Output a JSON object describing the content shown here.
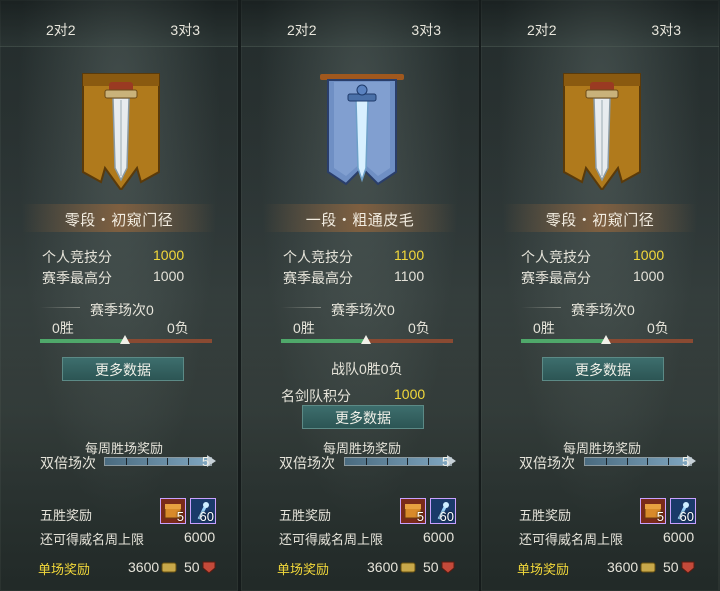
{
  "colors": {
    "gold": "#f2d83a",
    "win_bar": "#4fa86a",
    "loss_bar": "#8a4a32",
    "button": "#2c5554",
    "highlight_label": "#f2d83a"
  },
  "panels": [
    {
      "tabs": [
        "2对2",
        "3对3"
      ],
      "emblem": "gold-banner-sword-icon",
      "rank": "零段・初窥门径",
      "personal_label": "个人竞技分",
      "personal_value": "1000",
      "season_high_label": "赛季最高分",
      "season_high_value": "1000",
      "season_matches": "赛季场次0",
      "wins": "0胜",
      "losses": "0负",
      "more_button": "更多数据",
      "weekly_title": "每周胜场奖励",
      "double_label": "双倍场次",
      "double_count": "5",
      "double_progress": 1.0,
      "five_win_label": "五胜奖励",
      "item1_count": "5",
      "item2_count": "60",
      "prestige_label": "还可得威名周上限",
      "prestige_value": "6000",
      "single_label": "单场奖励",
      "single_coin": "3600",
      "single_token": "50"
    },
    {
      "tabs": [
        "2对2",
        "3对3"
      ],
      "emblem": "blue-banner-sword-icon",
      "rank": "一段・粗通皮毛",
      "personal_label": "个人竞技分",
      "personal_value": "1100",
      "season_high_label": "赛季最高分",
      "season_high_value": "1100",
      "season_matches": "赛季场次0",
      "wins": "0胜",
      "losses": "0负",
      "team_record": "战队0胜0负",
      "team_score_label": "名剑队积分",
      "team_score_value": "1000",
      "more_button": "更多数据",
      "weekly_title": "每周胜场奖励",
      "double_label": "双倍场次",
      "double_count": "5",
      "double_progress": 1.0,
      "five_win_label": "五胜奖励",
      "item1_count": "5",
      "item2_count": "60",
      "prestige_label": "还可得威名周上限",
      "prestige_value": "6000",
      "single_label": "单场奖励",
      "single_coin": "3600",
      "single_token": "50"
    },
    {
      "tabs": [
        "2对2",
        "3对3"
      ],
      "emblem": "gold-banner-sword-icon",
      "rank": "零段・初窥门径",
      "personal_label": "个人竞技分",
      "personal_value": "1000",
      "season_high_label": "赛季最高分",
      "season_high_value": "1000",
      "season_matches": "赛季场次0",
      "wins": "0胜",
      "losses": "0负",
      "more_button": "更多数据",
      "weekly_title": "每周胜场奖励",
      "double_label": "双倍场次",
      "double_count": "5",
      "double_progress": 1.0,
      "five_win_label": "五胜奖励",
      "item1_count": "5",
      "item2_count": "60",
      "prestige_label": "还可得威名周上限",
      "prestige_value": "6000",
      "single_label": "单场奖励",
      "single_coin": "3600",
      "single_token": "50"
    }
  ]
}
